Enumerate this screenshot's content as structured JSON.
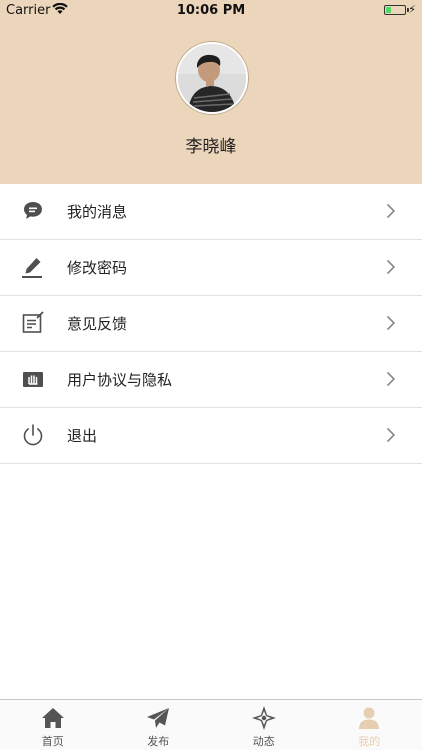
{
  "status_bar": {
    "carrier": "Carrier",
    "time": "10:06 PM",
    "battery_level": 0.25
  },
  "profile": {
    "username": "李晓峰"
  },
  "menu": [
    {
      "label": "我的消息",
      "icon": "message-icon"
    },
    {
      "label": "修改密码",
      "icon": "edit-pen-icon"
    },
    {
      "label": "意见反馈",
      "icon": "feedback-icon"
    },
    {
      "label": "用户协议与隐私",
      "icon": "agreement-icon"
    },
    {
      "label": "退出",
      "icon": "power-icon"
    }
  ],
  "tabs": [
    {
      "label": "首页",
      "icon": "home-icon"
    },
    {
      "label": "发布",
      "icon": "send-icon"
    },
    {
      "label": "动态",
      "icon": "compass-icon"
    },
    {
      "label": "我的",
      "icon": "profile-icon",
      "active": true
    }
  ],
  "colors": {
    "header_bg": "#ecd6bb",
    "active_tab": "#e5cfb0",
    "icon_gray": "#555555"
  }
}
